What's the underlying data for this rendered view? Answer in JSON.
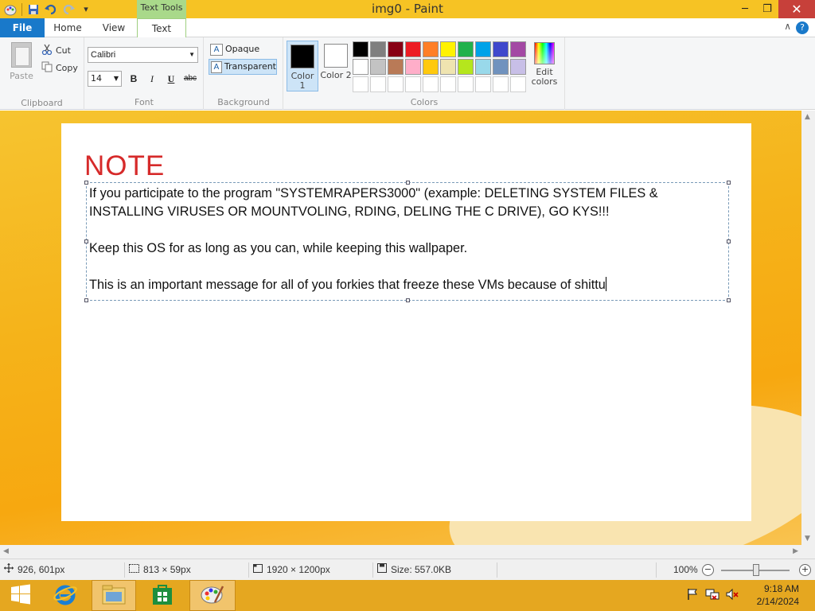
{
  "window": {
    "title": "img0 - Paint",
    "context_tab_group": "Text Tools"
  },
  "window_controls": {
    "minimize": "─",
    "restore": "❐",
    "close": "✕"
  },
  "quick_access": {
    "dropdown": "▾"
  },
  "tabs": {
    "file": "File",
    "home": "Home",
    "view": "View",
    "text": "Text"
  },
  "help": {
    "label": "?",
    "collapse": "∧"
  },
  "ribbon": {
    "clipboard": {
      "paste": "Paste",
      "cut": "Cut",
      "copy": "Copy",
      "group_label": "Clipboard"
    },
    "font": {
      "family": "Calibri",
      "size": "14",
      "bold": "B",
      "italic": "I",
      "underline": "U",
      "strikethrough": "abc",
      "group_label": "Font"
    },
    "background": {
      "opaque": "Opaque",
      "transparent": "Transparent",
      "group_label": "Background",
      "icon_letter": "A"
    },
    "colors": {
      "color1_label": "Color 1",
      "color2_label": "Color 2",
      "color1": "#000000",
      "color2": "#ffffff",
      "edit_colors": "Edit colors",
      "group_label": "Colors",
      "palette": [
        "#000000",
        "#7f7f7f",
        "#880015",
        "#ed1c24",
        "#ff7f27",
        "#fff200",
        "#22b14c",
        "#00a2e8",
        "#3f48cc",
        "#a349a4",
        "#ffffff",
        "#c3c3c3",
        "#b97a57",
        "#ffaec9",
        "#ffc90e",
        "#efe4b0",
        "#b5e61d",
        "#99d9ea",
        "#7092be",
        "#c8bfe7",
        "#ffffff",
        "#ffffff",
        "#ffffff",
        "#ffffff",
        "#ffffff",
        "#ffffff",
        "#ffffff",
        "#ffffff",
        "#ffffff",
        "#ffffff"
      ]
    }
  },
  "canvas": {
    "note_title": "NOTE",
    "paragraph1": "If you participate to the program \"SYSTEMRAPERS3000\" (example: DELETING SYSTEM FILES & INSTALLING VIRUSES OR MOUNTVOLING, RDING, DELING THE C DRIVE), GO KYS!!!",
    "paragraph2": "Keep this OS for as long as you can, while keeping this wallpaper.",
    "paragraph3": "This is an important message for all of you forkies that freeze these VMs because of shittu"
  },
  "status": {
    "cursor_pos": "926, 601px",
    "selection_size": "813 × 59px",
    "image_size": "1920 × 1200px",
    "file_size": "Size: 557.0KB",
    "zoom": "100%",
    "zoom_out": "−",
    "zoom_in": "+"
  },
  "taskbar": {
    "time": "9:18 AM",
    "date": "2/14/2024"
  }
}
